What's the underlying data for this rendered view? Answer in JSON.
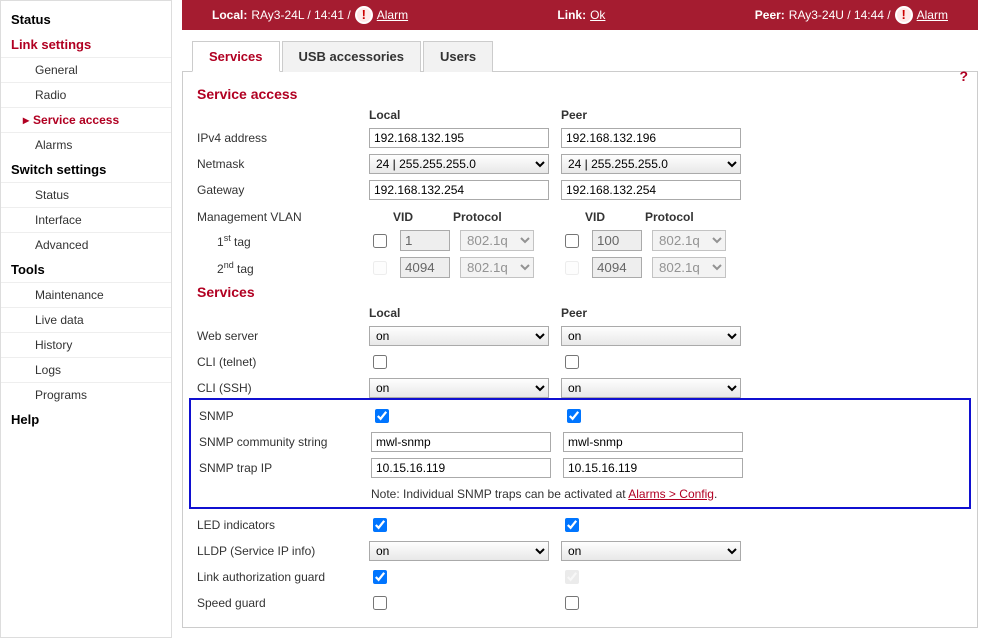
{
  "sidebar": {
    "status": "Status",
    "link_settings": "Link settings",
    "general": "General",
    "radio": "Radio",
    "service_access": "Service access",
    "alarms": "Alarms",
    "switch_settings": "Switch settings",
    "sw_status": "Status",
    "interface": "Interface",
    "advanced": "Advanced",
    "tools": "Tools",
    "maintenance": "Maintenance",
    "live_data": "Live data",
    "history": "History",
    "logs": "Logs",
    "programs": "Programs",
    "help": "Help"
  },
  "topbar": {
    "local_label": "Local:",
    "local_val": "RAy3-24L / 14:41 /",
    "alarm": "Alarm",
    "link_label": "Link:",
    "link_val": "Ok",
    "peer_label": "Peer:",
    "peer_val": "RAy3-24U / 14:44 /"
  },
  "tabs": {
    "services": "Services",
    "usb": "USB accessories",
    "users": "Users"
  },
  "help_q": "?",
  "sa": {
    "title": "Service access",
    "local": "Local",
    "peer": "Peer",
    "ipv4": "IPv4 address",
    "ipv4_local": "192.168.132.195",
    "ipv4_peer": "192.168.132.196",
    "netmask": "Netmask",
    "netmask_local": "24  |  255.255.255.0",
    "netmask_peer": "24  |  255.255.255.0",
    "gateway": "Gateway",
    "gateway_local": "192.168.132.254",
    "gateway_peer": "192.168.132.254",
    "mgmt_vlan": "Management VLAN",
    "vid": "VID",
    "protocol": "Protocol",
    "tag1": "1",
    "tag1_suffix": "st",
    "tag1_label": " tag",
    "tag2": "2",
    "tag2_suffix": "nd",
    "tag2_label": " tag",
    "tag1_vid_local": "1",
    "tag1_proto_local": "802.1q",
    "tag1_vid_peer": "100",
    "tag1_proto_peer": "802.1q",
    "tag2_vid_local": "4094",
    "tag2_proto_local": "802.1q",
    "tag2_vid_peer": "4094",
    "tag2_proto_peer": "802.1q"
  },
  "svc": {
    "title": "Services",
    "local": "Local",
    "peer": "Peer",
    "web": "Web server",
    "web_local": "on",
    "web_peer": "on",
    "cli_telnet": "CLI (telnet)",
    "cli_ssh": "CLI (SSH)",
    "cli_ssh_local": "on",
    "cli_ssh_peer": "on",
    "snmp": "SNMP",
    "snmp_comm": "SNMP community string",
    "snmp_comm_local": "mwl-snmp",
    "snmp_comm_peer": "mwl-snmp",
    "snmp_trap": "SNMP trap IP",
    "snmp_trap_local": "10.15.16.119",
    "snmp_trap_peer": "10.15.16.119",
    "snmp_note_pre": "Note: Individual SNMP traps can be activated at ",
    "snmp_note_link": "Alarms > Config",
    "snmp_note_post": ".",
    "led": "LED indicators",
    "lldp": "LLDP (Service IP info)",
    "lldp_local": "on",
    "lldp_peer": "on",
    "link_auth": "Link authorization guard",
    "speed_guard": "Speed guard"
  }
}
